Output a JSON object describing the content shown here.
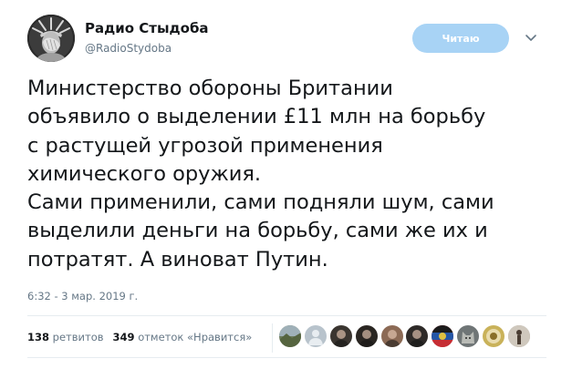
{
  "author": {
    "name": "Радио Стыдоба",
    "handle": "@RadioStydoba",
    "avatar_icon": "statue-of-liberty-facepalm-avatar"
  },
  "follow_button": {
    "label": "Читаю",
    "color": "#a8d3f5"
  },
  "menu_icon": "chevron-down-icon",
  "tweet": {
    "lines": [
      "Министерство обороны Британии",
      "объявило о выделении £11 млн на борьбу",
      "с растущей угрозой применения",
      "химического оружия.",
      "Сами применили, сами подняли шум, сами",
      "выделили деньги на борьбу, сами же их и",
      "потратят. А виноват Путин."
    ]
  },
  "timestamp": "6:32 - 3 мар. 2019 г.",
  "stats": {
    "retweets_count": "138",
    "retweets_label": "ретвитов",
    "likes_count": "349",
    "likes_label": "отметок «Нравится»"
  },
  "likers": [
    {
      "icon": "landscape-avatar",
      "color": "#6b7a5a"
    },
    {
      "icon": "default-egg-avatar",
      "color": "#b8c3cc"
    },
    {
      "icon": "person-photo-avatar",
      "color": "#3a3530"
    },
    {
      "icon": "person-photo-avatar",
      "color": "#2a2622"
    },
    {
      "icon": "person-photo-avatar",
      "color": "#8c6a55"
    },
    {
      "icon": "person-photo-avatar",
      "color": "#2e2a28"
    },
    {
      "icon": "flag-avatar",
      "color": "#c62d34"
    },
    {
      "icon": "cat-avatar",
      "color": "#6f7576"
    },
    {
      "icon": "emblem-avatar",
      "color": "#c9b25a"
    },
    {
      "icon": "person-silhouette-avatar",
      "color": "#a7a096"
    }
  ]
}
